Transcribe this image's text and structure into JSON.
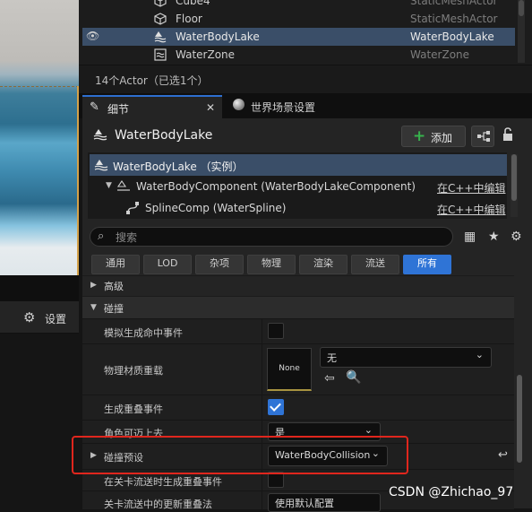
{
  "outliner": {
    "rows": [
      {
        "name": "Cube4",
        "type": "StaticMeshActor",
        "icon": "cube-icon",
        "selected": false
      },
      {
        "name": "Floor",
        "type": "StaticMeshActor",
        "icon": "cube-icon",
        "selected": false
      },
      {
        "name": "WaterBodyLake",
        "type": "WaterBodyLake",
        "icon": "water-icon",
        "selected": true
      },
      {
        "name": "WaterZone",
        "type": "WaterZone",
        "icon": "water-zone-icon",
        "selected": false
      }
    ],
    "actor_count": "14个Actor（已选1个）"
  },
  "tabs": {
    "details": "细节",
    "world_settings": "世界场景设置"
  },
  "details": {
    "actor_title": "WaterBodyLake",
    "add_label": "添加"
  },
  "components": [
    {
      "name": "WaterBodyLake （实例）",
      "edit": ""
    },
    {
      "name": "WaterBodyComponent (WaterBodyLakeComponent)",
      "edit": "在C++中编辑"
    },
    {
      "name": "SplineComp (WaterSpline)",
      "edit": "在C++中编辑"
    }
  ],
  "search": {
    "placeholder": "搜索"
  },
  "filters": [
    "通用",
    "LOD",
    "杂项",
    "物理",
    "渲染",
    "流送",
    "所有"
  ],
  "active_filter": "所有",
  "categories": {
    "advanced": "高级",
    "collision": "碰撞"
  },
  "properties": {
    "sim_hit_events": "模拟生成命中事件",
    "phys_material_override": "物理材质重载",
    "phys_material_value": "无",
    "material_thumb": "None",
    "gen_overlap_events": "生成重叠事件",
    "can_step_up": "角色可迈上去",
    "can_step_up_value": "是",
    "collision_presets": "碰撞预设",
    "collision_presets_value": "WaterBodyCollision",
    "gen_overlap_streaming": "在关卡流送时生成重叠事件",
    "level_streaming_overlap": "关卡流送中的更新重叠法",
    "level_streaming_overlap_value": "使用默认配置"
  },
  "left_panel": {
    "settings_label": "设置"
  },
  "watermark": "CSDN @Zhichao_97",
  "colors": {
    "accent": "#2f74d6",
    "selection": "#3a4e68",
    "highlight": "#e0261d",
    "add_plus": "#37b24d"
  }
}
